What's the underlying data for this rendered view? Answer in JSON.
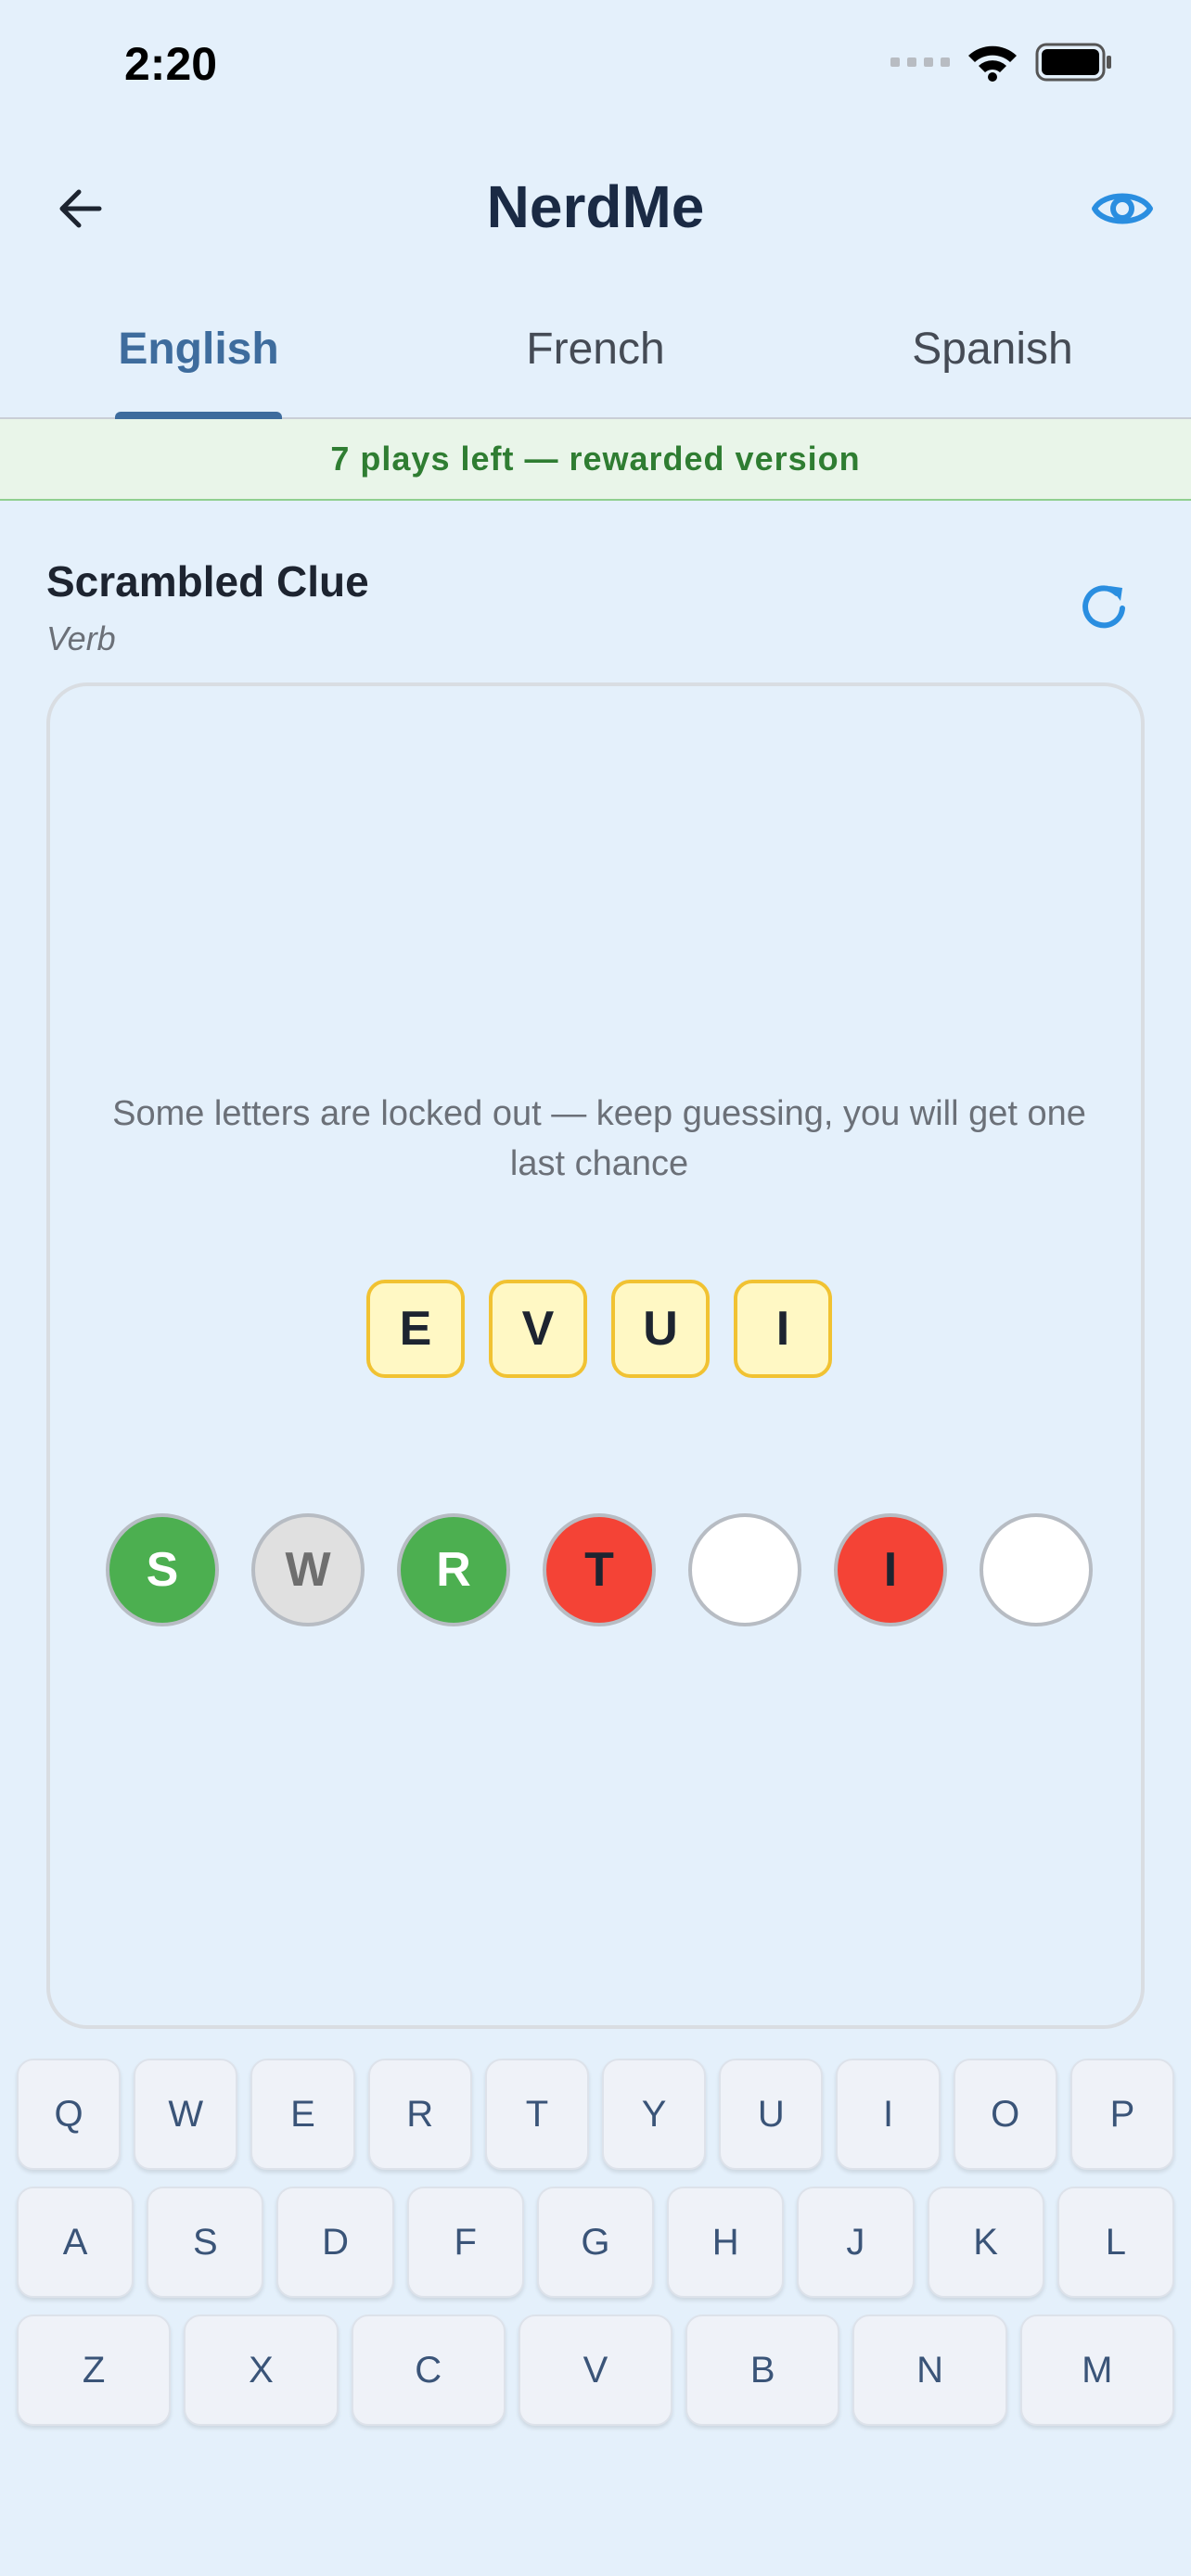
{
  "status_bar": {
    "time": "2:20"
  },
  "app_bar": {
    "title": "NerdMe",
    "back_icon": "arrow-left-icon",
    "reveal_icon": "eye-icon"
  },
  "tabs": [
    {
      "label": "English",
      "active": true
    },
    {
      "label": "French",
      "active": false
    },
    {
      "label": "Spanish",
      "active": false
    }
  ],
  "banner": {
    "text": "7 plays left — rewarded version"
  },
  "clue": {
    "title": "Scrambled Clue",
    "word_type": "Verb",
    "refresh_icon": "refresh-icon"
  },
  "game": {
    "hint": "Some letters are locked out — keep guessing, you will get one last chance",
    "scrambled_letters": [
      "E",
      "V",
      "U",
      "I"
    ],
    "guess_slots": [
      {
        "letter": "S",
        "state": "correct"
      },
      {
        "letter": "W",
        "state": "excluded"
      },
      {
        "letter": "R",
        "state": "correct"
      },
      {
        "letter": "T",
        "state": "wrong"
      },
      {
        "letter": "",
        "state": "empty"
      },
      {
        "letter": "I",
        "state": "wrong"
      },
      {
        "letter": "",
        "state": "empty"
      }
    ]
  },
  "keyboard": {
    "rows": [
      [
        "Q",
        "W",
        "E",
        "R",
        "T",
        "Y",
        "U",
        "I",
        "O",
        "P"
      ],
      [
        "A",
        "S",
        "D",
        "F",
        "G",
        "H",
        "J",
        "K",
        "L"
      ],
      [
        "Z",
        "X",
        "C",
        "V",
        "B",
        "N",
        "M"
      ]
    ]
  },
  "colors": {
    "background": "#e4f0fb",
    "accent": "#3e6c9d",
    "correct": "#4caf50",
    "wrong": "#f44336",
    "excluded": "#e0e0e0",
    "tile_fill": "#fff8c4",
    "tile_border": "#f1c232",
    "banner_text": "#2f7d32"
  }
}
